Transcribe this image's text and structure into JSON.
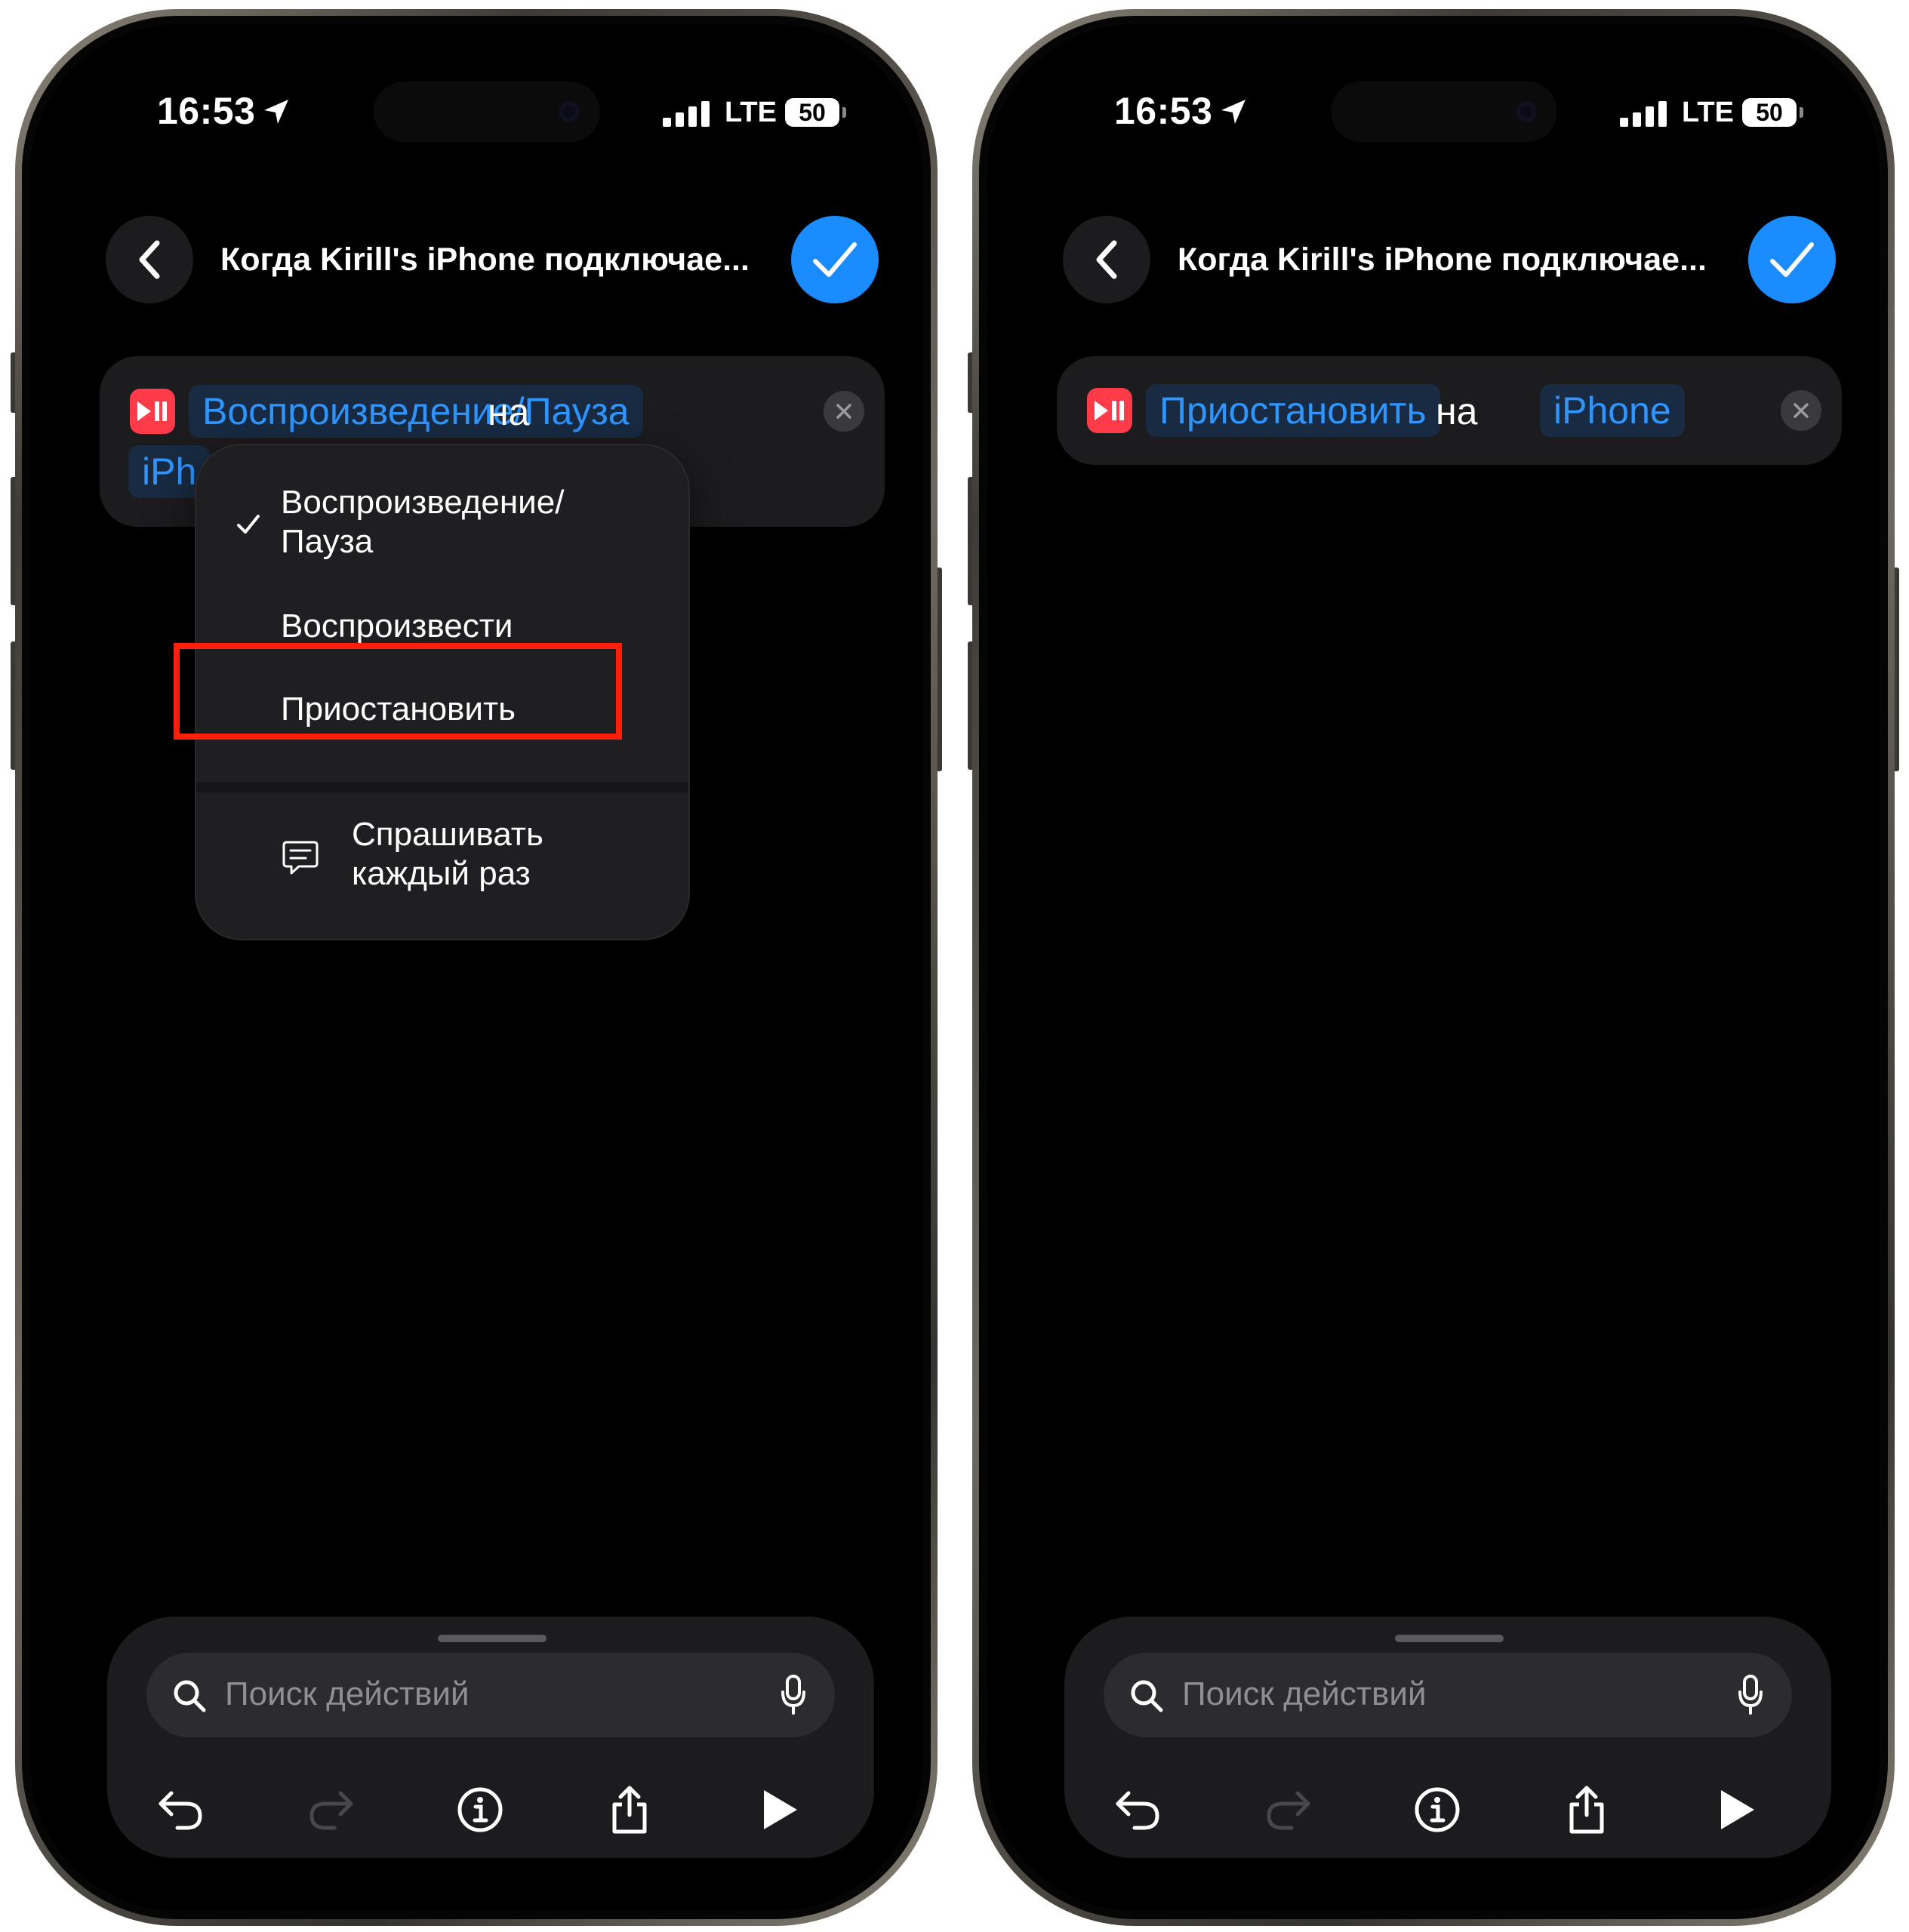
{
  "colors": {
    "accent_blue": "#1a8cff",
    "token_text": "#2f95ff",
    "token_bg": "#182b42",
    "card_bg": "#1c1c1e",
    "app_icon_red": "#ff3b4a",
    "highlight_red": "#ff1f0a"
  },
  "left": {
    "status": {
      "time": "16:53",
      "network": "LTE",
      "battery": "50"
    },
    "nav": {
      "title": "Когда Kirill's iPhone подключае..."
    },
    "action": {
      "token_action": "Воспроизведение/Пауза",
      "connector": "на",
      "token_device": "iPh"
    },
    "menu": {
      "items": [
        {
          "label_line1": "Воспроизведение/",
          "label_line2": "Пауза",
          "checked": true
        },
        {
          "label": "Воспроизвести",
          "checked": false
        },
        {
          "label": "Приостановить",
          "checked": false,
          "highlighted": true
        }
      ],
      "ask": {
        "label_line1": "Спрашивать",
        "label_line2": "каждый раз"
      }
    },
    "search": {
      "placeholder": "Поиск действий"
    }
  },
  "right": {
    "status": {
      "time": "16:53",
      "network": "LTE",
      "battery": "50"
    },
    "nav": {
      "title": "Когда Kirill's iPhone подключае..."
    },
    "action": {
      "token_action": "Приостановить",
      "connector": "на",
      "token_device": "iPhone"
    },
    "search": {
      "placeholder": "Поиск действий"
    }
  },
  "icons": [
    "location-arrow-icon",
    "signal-icon",
    "battery-icon",
    "back-chevron-icon",
    "checkmark-icon",
    "play-pause-icon",
    "clear-x-icon",
    "menu-check-icon",
    "chat-bubble-icon",
    "search-icon",
    "mic-icon",
    "undo-icon",
    "redo-icon",
    "info-icon",
    "share-icon",
    "play-icon"
  ]
}
